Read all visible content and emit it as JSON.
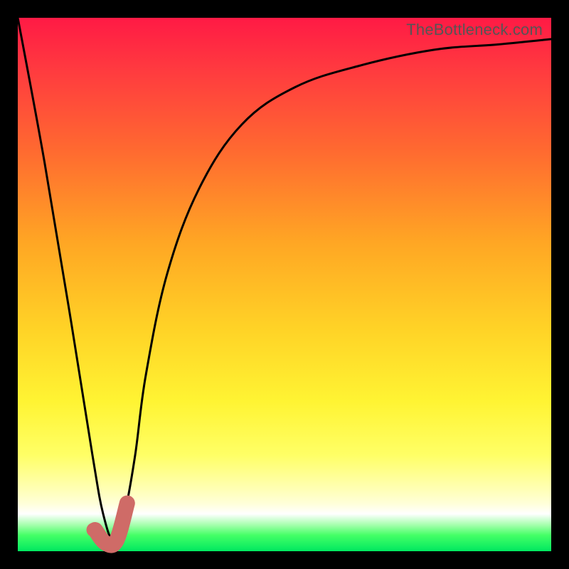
{
  "watermark": "TheBottleneck.com",
  "colors": {
    "frame": "#000000",
    "curve": "#000000",
    "marker": "#cf6b67",
    "gradient_top": "#ff1a45",
    "gradient_mid": "#ffd226",
    "gradient_bottom": "#00e860"
  },
  "chart_data": {
    "type": "line",
    "title": "",
    "xlabel": "",
    "ylabel": "",
    "xlim": [
      0,
      100
    ],
    "ylim": [
      0,
      100
    ],
    "series": [
      {
        "name": "bottleneck-curve",
        "x": [
          0,
          5,
          10,
          14,
          16,
          18,
          20,
          22,
          24,
          28,
          34,
          42,
          52,
          64,
          78,
          90,
          100
        ],
        "values": [
          100,
          73,
          43,
          18,
          7,
          2,
          7,
          18,
          33,
          52,
          68,
          80,
          87,
          91,
          94,
          95,
          96
        ]
      }
    ],
    "marker": {
      "name": "highlighted-range",
      "x": [
        14.5,
        16.5,
        18.5,
        20.5
      ],
      "values": [
        4,
        1.5,
        2,
        9
      ]
    },
    "marker_point": {
      "x": 14.2,
      "y": 4
    }
  }
}
